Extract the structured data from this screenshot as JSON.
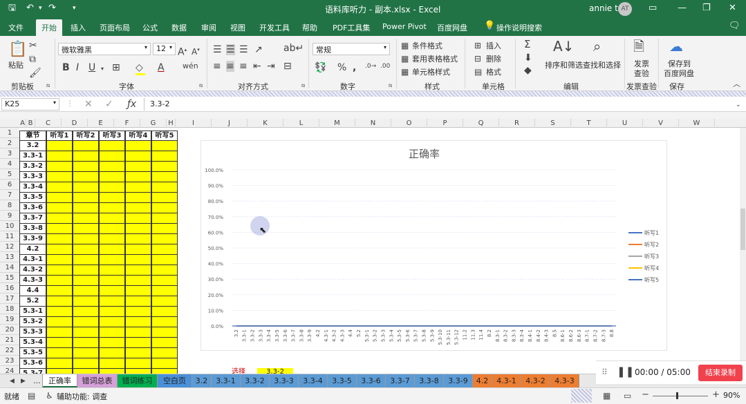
{
  "window": {
    "title": "语料库听力 - 副本.xlsx - Excel",
    "user": "annie t",
    "avatar": "AT"
  },
  "menu": [
    "文件",
    "开始",
    "插入",
    "页面布局",
    "公式",
    "数据",
    "审阅",
    "视图",
    "开发工具",
    "帮助",
    "PDF工具集",
    "Power Pivot",
    "百度网盘",
    "操作说明搜索"
  ],
  "ribbon": {
    "paste": "粘贴",
    "font_name": "微软雅黑",
    "font_size": "12",
    "bold": "B",
    "italic": "I",
    "underline": "U",
    "number_format": "常规",
    "percent": "%",
    "comma": ",",
    "cond_format": "条件格式",
    "table_format": "套用表格格式",
    "cell_style": "单元格样式",
    "insert": "插入",
    "delete": "删除",
    "format": "格式",
    "sort_filter": "排序和筛选",
    "find_select": "查找和选择",
    "invoice_check": "发票\n查验",
    "invoice1": "发票",
    "invoice2": "查验",
    "save_baidu1": "保存到",
    "save_baidu2": "百度网盘",
    "groups": {
      "clipboard": "剪贴板",
      "font": "字体",
      "align": "对齐方式",
      "number": "数字",
      "style": "样式",
      "cells": "单元格",
      "edit": "编辑",
      "invoice": "发票查验",
      "save": "保存"
    }
  },
  "formula": {
    "namebox": "K25",
    "value": "3.3-2"
  },
  "columns": [
    "A",
    "B",
    "C",
    "D",
    "E",
    "F",
    "G",
    "H",
    "I",
    "J",
    "K",
    "L",
    "M",
    "N",
    "O",
    "P",
    "Q",
    "R",
    "S",
    "T",
    "U",
    "V",
    "W"
  ],
  "rows": [
    "1",
    "2",
    "3",
    "4",
    "5",
    "6",
    "7",
    "8",
    "9",
    "10",
    "11",
    "12",
    "13",
    "14",
    "15",
    "16",
    "17",
    "18",
    "19",
    "20",
    "21",
    "22",
    "23",
    "24",
    "25"
  ],
  "table": {
    "headers": [
      "章节",
      "听写1",
      "听写2",
      "听写3",
      "听写4",
      "听写5"
    ],
    "chapters": [
      "3.2",
      "3.3-1",
      "3.3-2",
      "3.3-3",
      "3.3-4",
      "3.3-5",
      "3.3-6",
      "3.3-7",
      "3.3-8",
      "3.3-9",
      "4.2",
      "4.3-1",
      "4.3-2",
      "4.3-3",
      "4.4",
      "5.2",
      "5.3-1",
      "5.3-2",
      "5.3-3",
      "5.3-4",
      "5.3-5",
      "5.3-6",
      "5.3-7"
    ]
  },
  "chart_data": {
    "type": "line",
    "title": "正确率",
    "ylim": [
      0,
      1.0
    ],
    "yticks": [
      "100.0%",
      "90.0%",
      "80.0%",
      "70.0%",
      "60.0%",
      "50.0%",
      "40.0%",
      "30.0%",
      "20.0%",
      "10.0%",
      "0.0%"
    ],
    "categories": [
      "3.2",
      "3.3-1",
      "3.3-2",
      "3.3-3",
      "3.3-4",
      "3.3-5",
      "3.3-6",
      "3.3-7",
      "3.3-8",
      "3.3-9",
      "4.2",
      "4.3-1",
      "4.3-2",
      "4.3-3",
      "4.4",
      "5.2",
      "5.3-1",
      "5.3-2",
      "5.3-3",
      "5.3-4",
      "5.3-5",
      "5.3-6",
      "5.3-7",
      "5.3-8",
      "5.3-9",
      "5.3-10",
      "5.3-11",
      "5.3-12",
      "11.2",
      "11.3",
      "11.4",
      "8.2",
      "8.3-1",
      "8.3-2",
      "8.3-3",
      "8.3-4",
      "8.4-1",
      "8.4-2",
      "8.4-3",
      "8.5",
      "8.6-1",
      "8.6-2",
      "8.6-3",
      "8.7-1",
      "8.7-2",
      "8.7-3",
      "8.8"
    ],
    "series": [
      {
        "name": "听写1",
        "color": "#4472c4",
        "values": [
          0
        ]
      },
      {
        "name": "听写2",
        "color": "#ed7d31",
        "values": [
          0
        ]
      },
      {
        "name": "听写3",
        "color": "#a5a5a5",
        "values": [
          0
        ]
      },
      {
        "name": "听写4",
        "color": "#ffc000",
        "values": [
          0
        ]
      },
      {
        "name": "听写5",
        "color": "#4472c4",
        "values": [
          0
        ]
      }
    ],
    "grid": true,
    "legend": "right"
  },
  "tabs": [
    {
      "label": "...",
      "color": "#e8e8e8",
      "w": 16
    },
    {
      "label": "正确率",
      "color": "#ffffff",
      "w": 50
    },
    {
      "label": "错词总表",
      "color": "#d4a0d8",
      "w": 58
    },
    {
      "label": "错词练习",
      "color": "#00b050",
      "w": 58
    },
    {
      "label": "空白页",
      "color": "#4a90d9",
      "w": 50
    },
    {
      "label": "3.2",
      "color": "#5b9bd5",
      "w": 28
    },
    {
      "label": "3.3-1",
      "color": "#5b9bd5",
      "w": 42
    },
    {
      "label": "3.3-2",
      "color": "#5b9bd5",
      "w": 42
    },
    {
      "label": "3.3-3",
      "color": "#5b9bd5",
      "w": 42
    },
    {
      "label": "3.3-4",
      "color": "#5b9bd5",
      "w": 42
    },
    {
      "label": "3.3-5",
      "color": "#5b9bd5",
      "w": 42
    },
    {
      "label": "3.3-6",
      "color": "#5b9bd5",
      "w": 42
    },
    {
      "label": "3.3-7",
      "color": "#5b9bd5",
      "w": 42
    },
    {
      "label": "3.3-8",
      "color": "#5b9bd5",
      "w": 42
    },
    {
      "label": "3.3-9",
      "color": "#5b9bd5",
      "w": 42
    },
    {
      "label": "4.2",
      "color": "#ed7d31",
      "w": 28
    },
    {
      "label": "4.3-1",
      "color": "#ed7d31",
      "w": 42
    },
    {
      "label": "4.3-2",
      "color": "#ed7d31",
      "w": 42
    },
    {
      "label": "4.3-3",
      "color": "#ed7d31",
      "w": 42
    }
  ],
  "misc": {
    "select_label": "选择",
    "select_value": "3.3-2"
  },
  "status": {
    "ready": "就绪",
    "accessibility": "辅助功能: 调查",
    "zoom": "90%"
  },
  "recorder": {
    "time": "00:00 / 05:00",
    "stop": "结束录制"
  }
}
